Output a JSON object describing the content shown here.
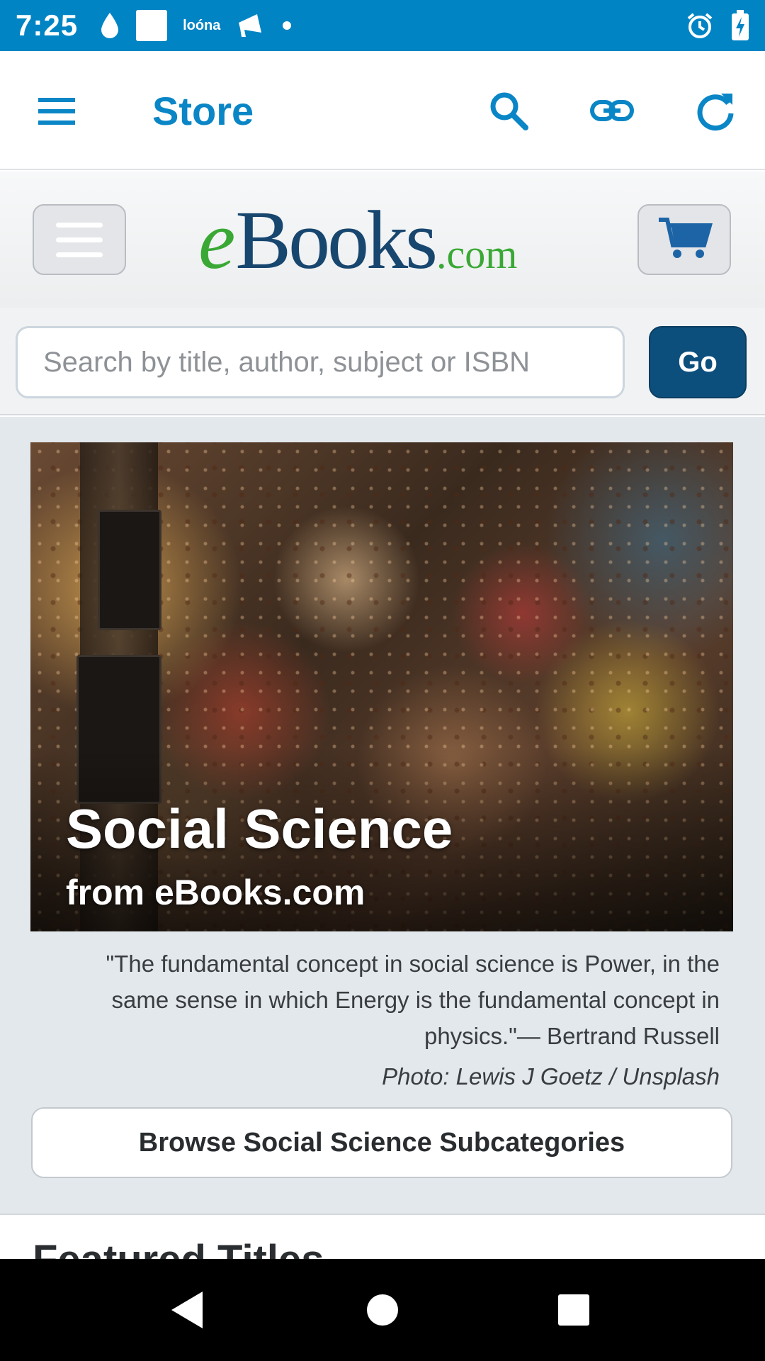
{
  "status_bar": {
    "time": "7:25",
    "left_icons": [
      "water-drop-icon",
      "square-notification-icon",
      "app-notification-text-icon",
      "megaphone-icon",
      "dot-icon"
    ],
    "notification_text": "loóna",
    "right_icons": [
      "alarm-icon",
      "battery-charging-icon"
    ],
    "background": "#0084c4"
  },
  "app_bar": {
    "title": "Store",
    "actions": [
      "search-icon",
      "link-icon",
      "refresh-icon"
    ],
    "accent": "#0a86c6"
  },
  "site_header": {
    "logo_e": "e",
    "logo_books": "Books",
    "logo_com": ".com",
    "logo_green": "#3aa835",
    "logo_navy": "#17466f"
  },
  "search": {
    "placeholder": "Search by title, author, subject or ISBN",
    "value": "",
    "go_label": "Go"
  },
  "hero": {
    "title": "Social Science",
    "subtitle": "from eBooks.com"
  },
  "quote": {
    "text": "\"The fundamental concept in social science is Power, in the same sense in which Energy is the fundamental concept in physics.\"— Bertrand Russell",
    "credit": "Photo: Lewis J Goetz / Unsplash"
  },
  "browse_button": {
    "label": "Browse Social Science Subcategories"
  },
  "featured": {
    "heading": "Featured Titles"
  },
  "nav_bar": {
    "buttons": [
      "back-icon",
      "home-icon",
      "recents-icon"
    ]
  }
}
